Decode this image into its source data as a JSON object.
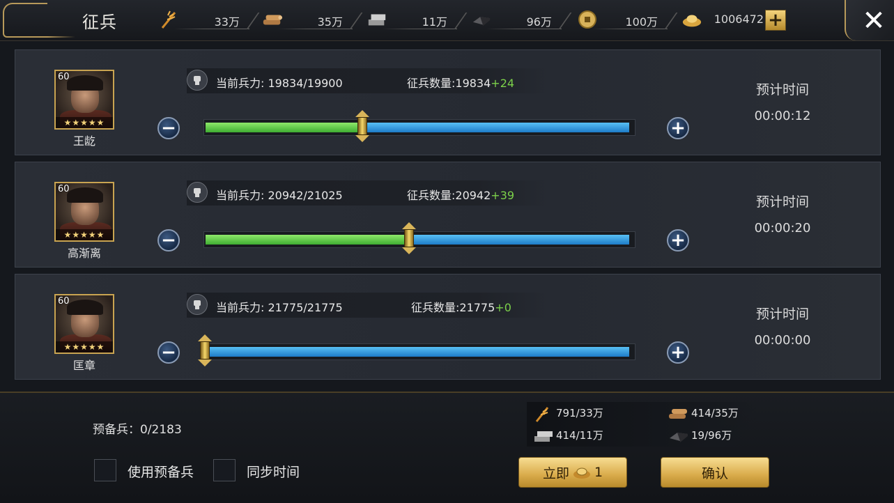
{
  "header": {
    "title": "征兵",
    "resources": [
      {
        "icon": "grain-icon",
        "amount": "33万"
      },
      {
        "icon": "wood-icon",
        "amount": "35万"
      },
      {
        "icon": "stone-icon",
        "amount": "11万"
      },
      {
        "icon": "iron-icon",
        "amount": "96万"
      },
      {
        "icon": "coin-icon",
        "amount": "100万"
      },
      {
        "icon": "gold-ingot-icon",
        "amount": "1006472"
      }
    ],
    "add_label": "+",
    "close_label": "✕"
  },
  "generals": [
    {
      "name": "王龁",
      "level": "60",
      "stars": "★★★★★",
      "power_text": "当前兵力: 19834/19900",
      "recruit_prefix": "征兵数量:19834",
      "recruit_plus": "+24",
      "eta_label": "预计时间",
      "eta_time": "00:00:12",
      "slider_fraction": 0.37
    },
    {
      "name": "高渐离",
      "level": "60",
      "stars": "★★★★★",
      "power_text": "当前兵力: 20942/21025",
      "recruit_prefix": "征兵数量:20942",
      "recruit_plus": "+39",
      "eta_label": "预计时间",
      "eta_time": "00:00:20",
      "slider_fraction": 0.48
    },
    {
      "name": "匡章",
      "level": "60",
      "stars": "★★★★★",
      "power_text": "当前兵力: 21775/21775",
      "recruit_prefix": "征兵数量:21775",
      "recruit_plus": "+0",
      "eta_label": "预计时间",
      "eta_time": "00:00:00",
      "slider_fraction": 0.0
    }
  ],
  "controls": {
    "minus_label": "−",
    "plus_label": "+"
  },
  "bottom": {
    "reserve_text": "预备兵：0/2183",
    "use_reserve_label": "使用预备兵",
    "sync_time_label": "同步时间",
    "costs": [
      {
        "icon": "grain-icon",
        "text": "791/33万"
      },
      {
        "icon": "wood-icon",
        "text": "414/35万"
      },
      {
        "icon": "stone-icon",
        "text": "414/11万"
      },
      {
        "icon": "iron-icon",
        "text": "19/96万"
      }
    ],
    "instant_label": "立即",
    "instant_cost": "1",
    "confirm_label": "确认"
  },
  "colors": {
    "accent_gold": "#c9a451",
    "slider_green": "#6fd24e",
    "slider_blue": "#2e94de",
    "bonus_green": "#7cd14a"
  }
}
